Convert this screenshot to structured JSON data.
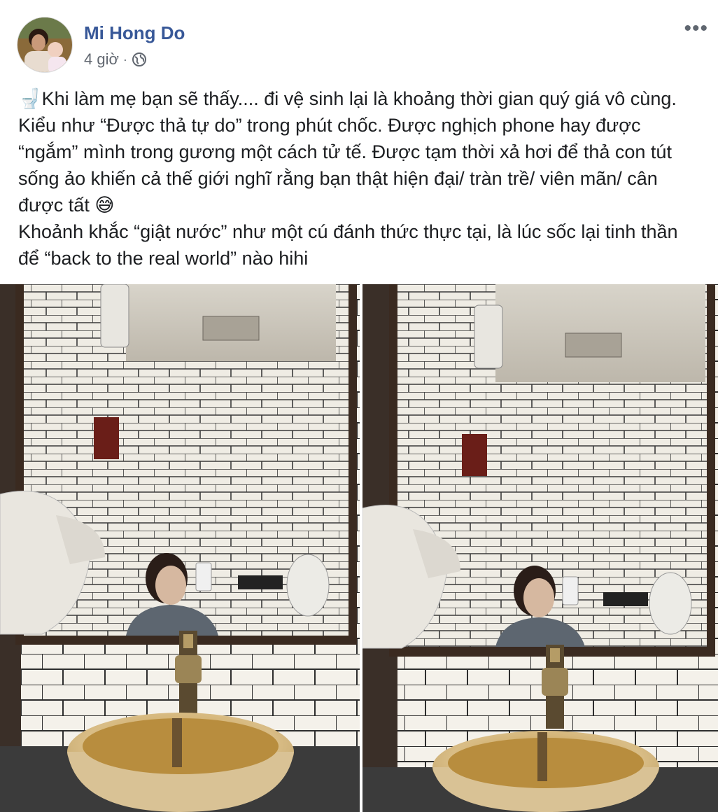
{
  "post": {
    "author": "Mi Hong Do",
    "time": "4 giờ",
    "separator": "·",
    "privacy_icon": "globe-icon",
    "more_icon": "more-dots-icon",
    "more_label": "•••",
    "leading_emoji": "🚽",
    "text_paragraph_1": "Khi làm mẹ bạn sẽ thấy.... đi vệ sinh lại là khoảng thời gian quý giá vô cùng. Kiểu như “Được thả tự do” trong phút chốc. Được nghịch phone hay được “ngắm” mình trong gương một cách tử tế. Được tạm thời xả hơi để thả con tút sống ảo khiến cả thế giới nghĩ rằng bạn thật hiện đại/ tràn trề/ viên mãn/ cân được tất",
    "trailing_emoji": "😅",
    "text_paragraph_2": "Khoảnh khắc “giật nước” như một cú đánh thức thực tại, là lúc sốc lại tinh thần để “back to the real world” nào hihi",
    "photos": [
      {
        "name": "photo-1",
        "description_icon": "bathroom-mirror-selfie"
      },
      {
        "name": "photo-2",
        "description_icon": "bathroom-mirror-selfie"
      }
    ]
  },
  "colors": {
    "author": "#385898",
    "meta": "#616770",
    "text": "#1c1e21",
    "tile": "#f2f0ea",
    "grout": "#2a2a2a",
    "frame": "#3a2a20",
    "basin": "#c9a86a"
  }
}
